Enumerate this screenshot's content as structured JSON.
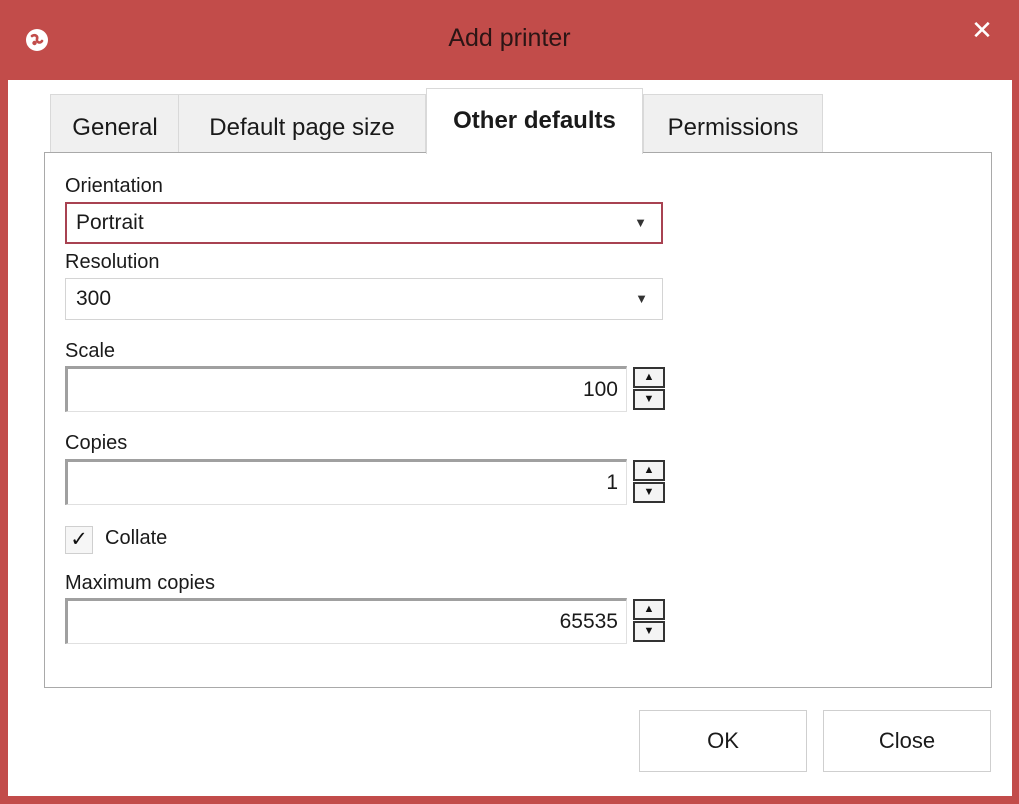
{
  "window": {
    "title": "Add printer",
    "close_glyph": "✕",
    "app_icon": "app-logo-icon",
    "accent_color": "#c24c4a"
  },
  "tabs": [
    {
      "label": "General",
      "active": false
    },
    {
      "label": "Default page size",
      "active": false
    },
    {
      "label": "Other defaults",
      "active": true
    },
    {
      "label": "Permissions",
      "active": false
    }
  ],
  "form": {
    "orientation": {
      "label": "Orientation",
      "value": "Portrait"
    },
    "resolution": {
      "label": "Resolution",
      "value": "300"
    },
    "scale": {
      "label": "Scale",
      "value": "100"
    },
    "copies": {
      "label": "Copies",
      "value": "1"
    },
    "collate": {
      "label": "Collate",
      "checked": true,
      "check_glyph": "✓"
    },
    "maximum_copies": {
      "label": "Maximum copies",
      "value": "65535"
    }
  },
  "buttons": {
    "ok": "OK",
    "close": "Close"
  },
  "glyphs": {
    "dropdown_arrow": "▼",
    "spin_up": "▲",
    "spin_down": "▼"
  }
}
